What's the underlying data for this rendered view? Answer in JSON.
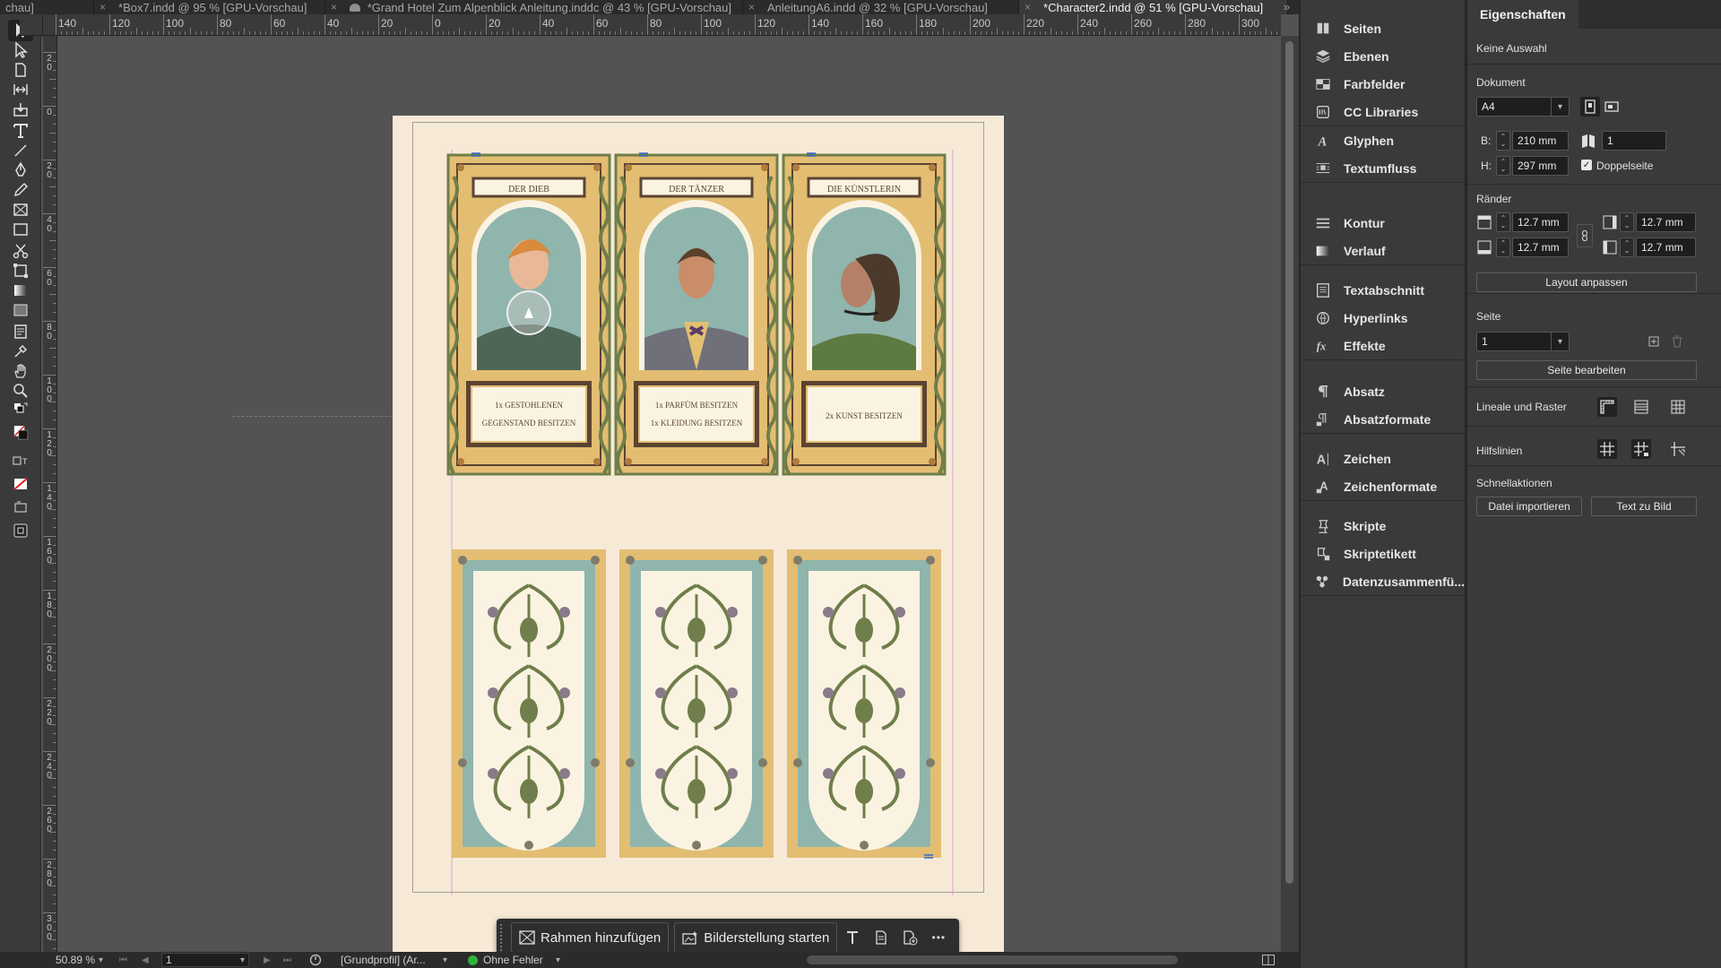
{
  "tabs": [
    {
      "label": "chau]",
      "active": false
    },
    {
      "label": "*Box7.indd @ 95 % [GPU-Vorschau]",
      "active": false
    },
    {
      "label": "*Grand Hotel Zum Alpenblick Anleitung.inddc @ 43 % [GPU-Vorschau]",
      "active": false,
      "cloud": true
    },
    {
      "label": "AnleitungA6.indd @ 32 % [GPU-Vorschau]",
      "active": false
    },
    {
      "label": "*Character2.indd @ 51 % [GPU-Vorschau]",
      "active": true
    }
  ],
  "tab_more": "»",
  "tab_close": "×",
  "ruler_h": [
    "140",
    "120",
    "100",
    "80",
    "60",
    "40",
    "20",
    "0",
    "20",
    "40",
    "60",
    "80",
    "100",
    "120",
    "140",
    "160",
    "180",
    "200",
    "220",
    "240",
    "260",
    "280",
    "300"
  ],
  "ruler_v": [
    "20",
    "0",
    "20",
    "40",
    "60",
    "80",
    "100",
    "120",
    "140",
    "160",
    "180",
    "200",
    "220",
    "240",
    "260",
    "280",
    "300"
  ],
  "canvas": {
    "cards_top": [
      {
        "title": "DER DIEB",
        "caption_lines": [
          "1x GESTOHLENEN",
          "GEGENSTAND BESITZEN"
        ]
      },
      {
        "title": "DER TÄNZER",
        "caption_lines": [
          "1x PARFÜM BESITZEN",
          "1x KLEIDUNG BESITZEN"
        ]
      },
      {
        "title": "DIE KÜNSTLERIN",
        "caption_lines": [
          "2x KUNST BESITZEN"
        ]
      }
    ]
  },
  "context_bar": {
    "add_frame": "Rahmen hinzufügen",
    "generate_image": "Bilderstellung starten",
    "more": "•••"
  },
  "status_bar": {
    "zoom": "50.89 %",
    "page": "1",
    "profile": "[Grundprofil] (Ar...",
    "errors": "Ohne Fehler"
  },
  "panels": [
    [
      "Seiten",
      "Ebenen",
      "Farbfelder",
      "CC Libraries"
    ],
    [
      "Glyphen",
      "Textumfluss"
    ],
    [
      "Kontur",
      "Verlauf"
    ],
    [
      "Textabschnitt",
      "Hyperlinks",
      "Effekte"
    ],
    [
      "Absatz",
      "Absatzformate"
    ],
    [
      "Zeichen",
      "Zeichenformate"
    ],
    [
      "Skripte",
      "Skriptetikett",
      "Datenzusammenfü..."
    ]
  ],
  "properties": {
    "tab": "Eigenschaften",
    "selection": "Keine Auswahl",
    "document_label": "Dokument",
    "page_size": "A4",
    "width_label": "B:",
    "width": "210 mm",
    "height_label": "H:",
    "height": "297 mm",
    "pages": "1",
    "facing_pages": "Doppelseite",
    "facing_checked": true,
    "margins_label": "Ränder",
    "margin_top": "12.7 mm",
    "margin_bottom": "12.7 mm",
    "margin_left": "12.7 mm",
    "margin_right": "12.7 mm",
    "adjust_layout": "Layout anpassen",
    "page_label": "Seite",
    "page_value": "1",
    "edit_page": "Seite bearbeiten",
    "rulers_grids": "Lineale und Raster",
    "guides": "Hilfslinien",
    "quick_actions": "Schnellaktionen",
    "import_file": "Datei importieren",
    "text_to_image": "Text zu Bild"
  },
  "colors": {
    "page": "#f6ead7",
    "card_green": "#6f7e4a",
    "card_gold": "#e3bd72",
    "card_teal": "#8fb5ac",
    "card_brown": "#5b4432",
    "accent_panel": "#3a3a3a"
  }
}
